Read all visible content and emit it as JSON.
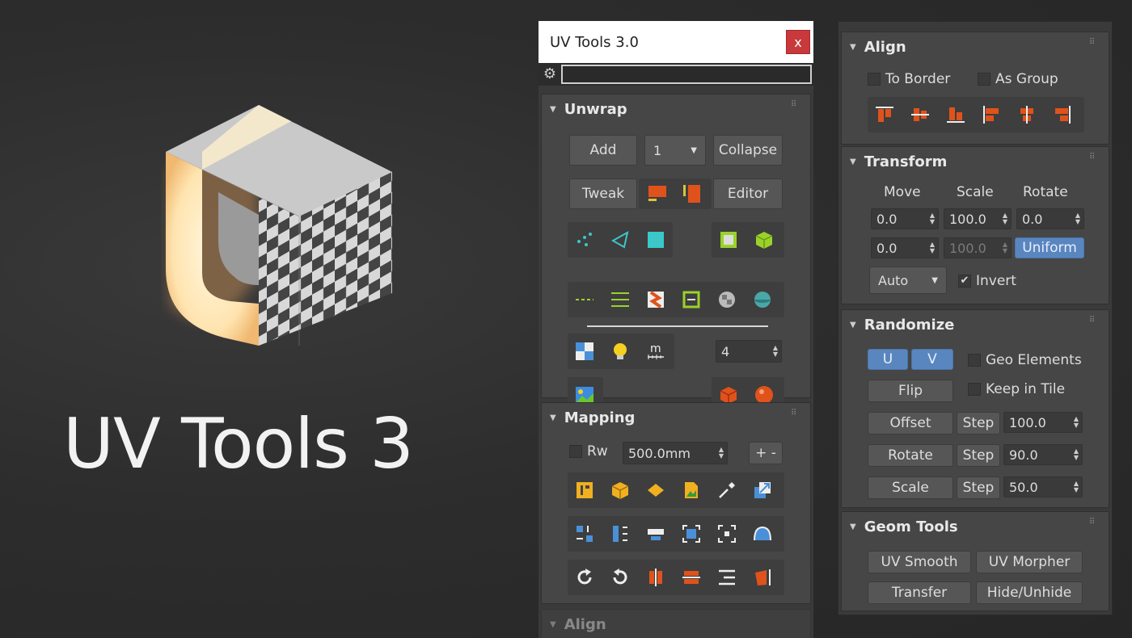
{
  "brand": {
    "text": "UV Tools 3"
  },
  "window": {
    "title": "UV Tools 3.0",
    "close_label": "x",
    "search_value": ""
  },
  "unwrap": {
    "title": "Unwrap",
    "add_label": "Add",
    "channel_value": "1",
    "collapse_label": "Collapse",
    "tweak_label": "Tweak",
    "editor_label": "Editor",
    "checker_value": "4"
  },
  "mapping": {
    "title": "Mapping",
    "rw_label": "Rw",
    "size_value": "500.0mm",
    "plusminus_label": "+ -"
  },
  "align_stub": {
    "title": "Align"
  },
  "align": {
    "title": "Align",
    "to_border_label": "To Border",
    "as_group_label": "As Group"
  },
  "transform": {
    "title": "Transform",
    "move_label": "Move",
    "scale_label": "Scale",
    "rotate_label": "Rotate",
    "move_u": "0.0",
    "scale_u": "100.0",
    "rotate_value": "0.0",
    "move_v": "0.0",
    "scale_v": "100.0",
    "uniform_label": "Uniform",
    "auto_value": "Auto",
    "invert_label": "Invert",
    "invert_checked": true
  },
  "randomize": {
    "title": "Randomize",
    "u_label": "U",
    "v_label": "V",
    "geo_elements_label": "Geo Elements",
    "flip_label": "Flip",
    "keep_in_tile_label": "Keep in Tile",
    "offset_label": "Offset",
    "offset_step_label": "Step",
    "offset_value": "100.0",
    "rotate_label": "Rotate",
    "rotate_step_label": "Step",
    "rotate_value": "90.0",
    "scale_label": "Scale",
    "scale_step_label": "Step",
    "scale_value": "50.0"
  },
  "geom_tools": {
    "title": "Geom Tools",
    "uv_smooth_label": "UV Smooth",
    "uv_morpher_label": "UV Morpher",
    "transfer_label": "Transfer",
    "hide_unhide_label": "Hide/Unhide"
  },
  "colors": {
    "accent_orange": "#e0521c",
    "accent_blue": "#5a86c0",
    "cyan": "#3cc7c9",
    "green": "#9bd22a"
  }
}
